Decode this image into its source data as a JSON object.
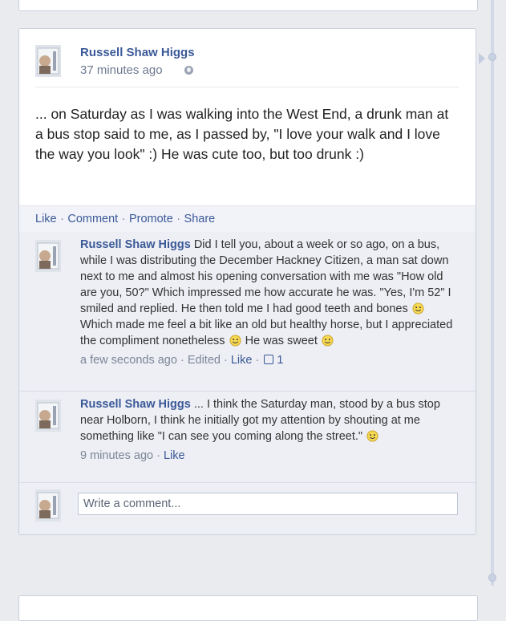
{
  "post": {
    "author": "Russell Shaw Higgs",
    "time": "37 minutes ago",
    "privacy_icon": "globe-icon",
    "text": "... on Saturday as I was walking into the West End, a drunk man at a bus stop said to me, as I passed by, \"I love your walk and I love the way you look\" :) He was cute too, but too drunk :)"
  },
  "actions": {
    "like": "Like",
    "comment": "Comment",
    "promote": "Promote",
    "share": "Share",
    "separator": "·"
  },
  "comments": [
    {
      "author": "Russell Shaw Higgs",
      "text_parts": [
        " Did I tell you, about a week or so ago, on a bus, while I was distributing the December Hackney Citizen, a man sat down next to me and almost his opening conversation with me was \"How old are you, 50?\" Which impressed me how accurate he was. \"Yes, I'm 52\" I smiled and replied. He then told me I had good teeth and bones ",
        " Which made me feel a bit like an old but healthy horse, but I appreciated the compliment nonetheless ",
        " He was sweet "
      ],
      "time": "a few seconds ago",
      "edited": "Edited",
      "like": "Like",
      "like_count": "1"
    },
    {
      "author": "Russell Shaw Higgs",
      "text_parts": [
        " ... I think the Saturday man, stood by a bus stop near Holborn, I think he initially got my attention by shouting at me something like \"I can see you coming along the street.\" "
      ],
      "time": "9 minutes ago",
      "like": "Like"
    }
  ],
  "write_comment": {
    "placeholder": "Write a comment..."
  },
  "colors": {
    "link": "#3b5998",
    "background": "#e9ebee",
    "comment_bg": "#edeff4"
  }
}
